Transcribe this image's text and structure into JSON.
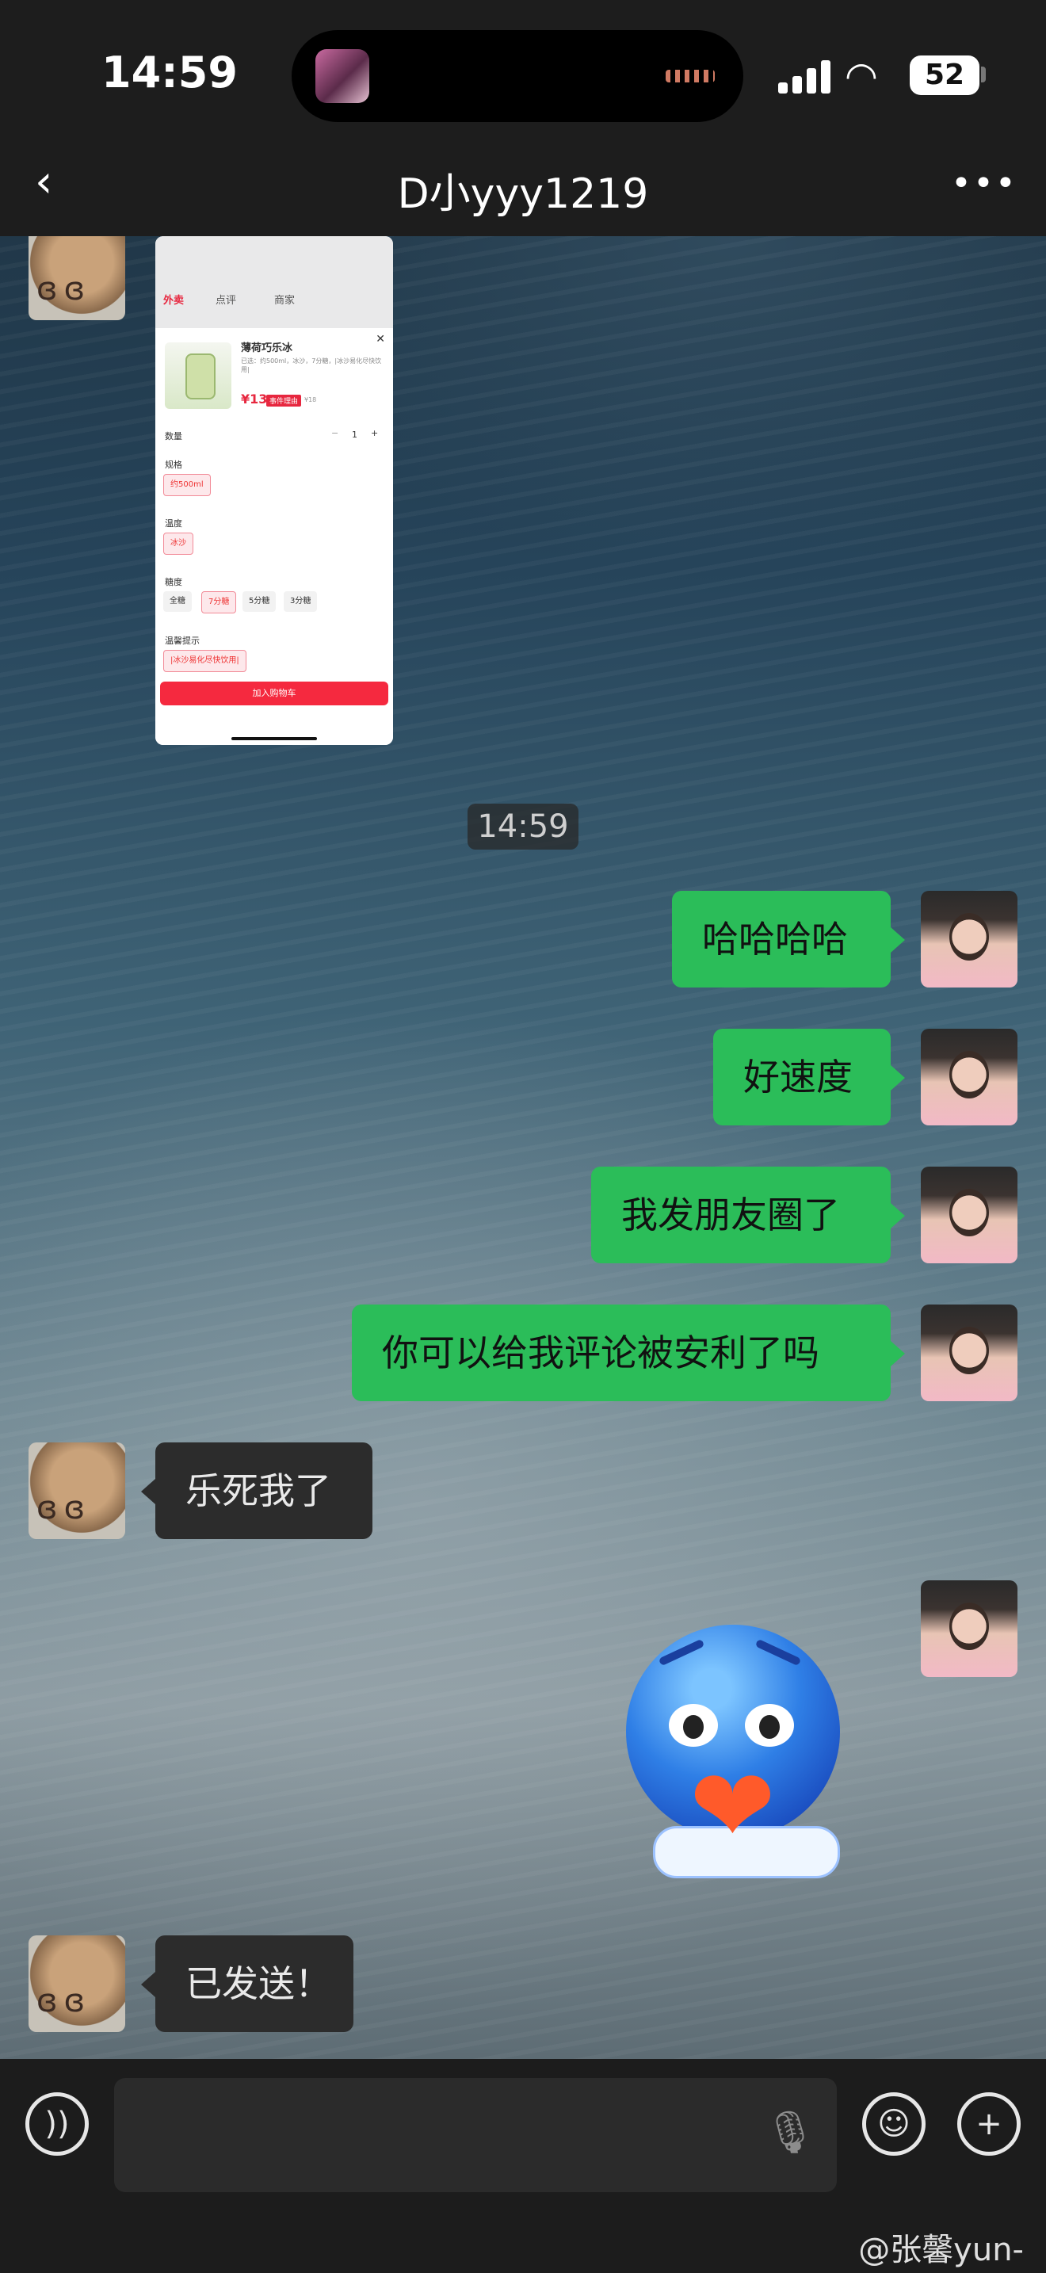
{
  "status_bar": {
    "time": "14:59",
    "battery": "52"
  },
  "nav": {
    "title": "D小yyy1219"
  },
  "shared_screenshot": {
    "tabs": [
      "外卖",
      "点评",
      "商家"
    ],
    "product_name": "薄荷巧乐冰",
    "product_desc": "已选：约500ml，冰沙，7分糖，|冰沙易化尽快饮用|",
    "price": "¥13",
    "price_tag": "事件理由",
    "original_price": "¥18",
    "quantity_label": "数量",
    "quantity_value": "1",
    "spec_label": "规格",
    "spec_option": "约500ml",
    "temp_label": "温度",
    "temp_option": "冰沙",
    "sugar_label": "糖度",
    "sugar_options": [
      "全糖",
      "7分糖",
      "5分糖",
      "3分糖"
    ],
    "tip_label": "温馨提示",
    "tip_option": "|冰沙易化尽快饮用|",
    "cart_button": "加入购物车"
  },
  "timestamp": "14:59",
  "messages": [
    {
      "sender": "me",
      "text": "哈哈哈哈"
    },
    {
      "sender": "me",
      "text": "好速度"
    },
    {
      "sender": "me",
      "text": "我发朋友圈了"
    },
    {
      "sender": "me",
      "text": "你可以给我评论被安利了吗"
    },
    {
      "sender": "friend",
      "text": "乐死我了"
    },
    {
      "sender": "friend",
      "text": "已发送！"
    }
  ],
  "input": {
    "placeholder": ""
  },
  "watermark": "@张馨yun-",
  "icons": [
    "chevron-left-icon",
    "more-icon",
    "voice-icon",
    "mic-icon",
    "emoji-icon",
    "plus-icon",
    "sticker-heart-emoji"
  ]
}
